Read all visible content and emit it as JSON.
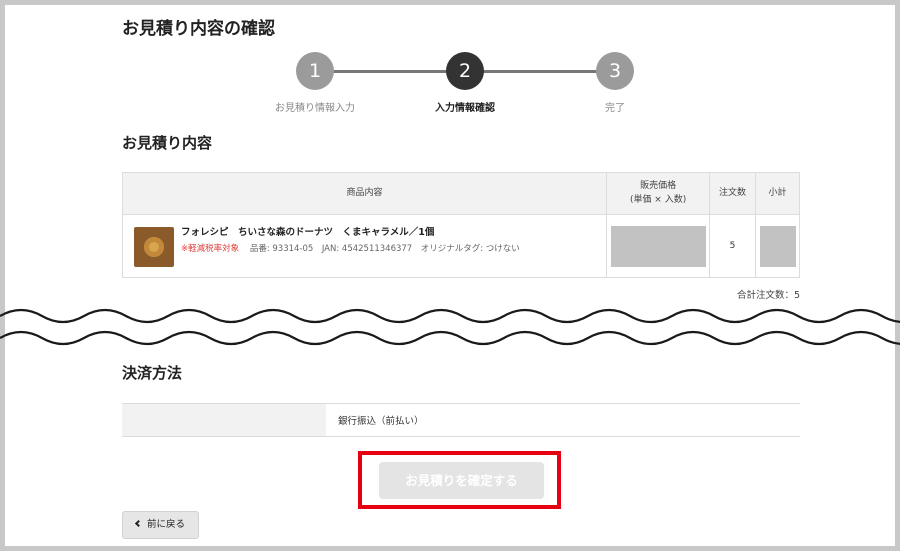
{
  "page": {
    "title": "お見積り内容の確認"
  },
  "stepper": {
    "steps": [
      {
        "number": "1",
        "label": "お見積り情報入力"
      },
      {
        "number": "2",
        "label": "入力情報確認"
      },
      {
        "number": "3",
        "label": "完了"
      }
    ],
    "active_step": 2
  },
  "estimate": {
    "section_title": "お見積り内容",
    "headers": {
      "product": "商品内容",
      "price_line1": "販売価格",
      "price_line2": "(単価 × 入数)",
      "quantity": "注文数",
      "subtotal": "小計"
    },
    "items": [
      {
        "name": "フォレシピ　ちいさな森のドーナツ　くまキャラメル／1個",
        "tax_note": "※軽減税率対象",
        "meta": "品番: 93314-05　JAN: 4542511346377　オリジナルタグ: つけない",
        "quantity": "5"
      }
    ],
    "total_quantity": "合計注文数：5"
  },
  "payment": {
    "section_title": "決済方法",
    "method": "銀行振込（前払い）"
  },
  "actions": {
    "confirm_label": "お見積りを確定する",
    "back_label": "前に戻る"
  },
  "colors": {
    "highlight_border": "#e60012",
    "tax_note": "#e0403a",
    "step_active": "#333333",
    "step_inactive": "#9b9b9b"
  }
}
